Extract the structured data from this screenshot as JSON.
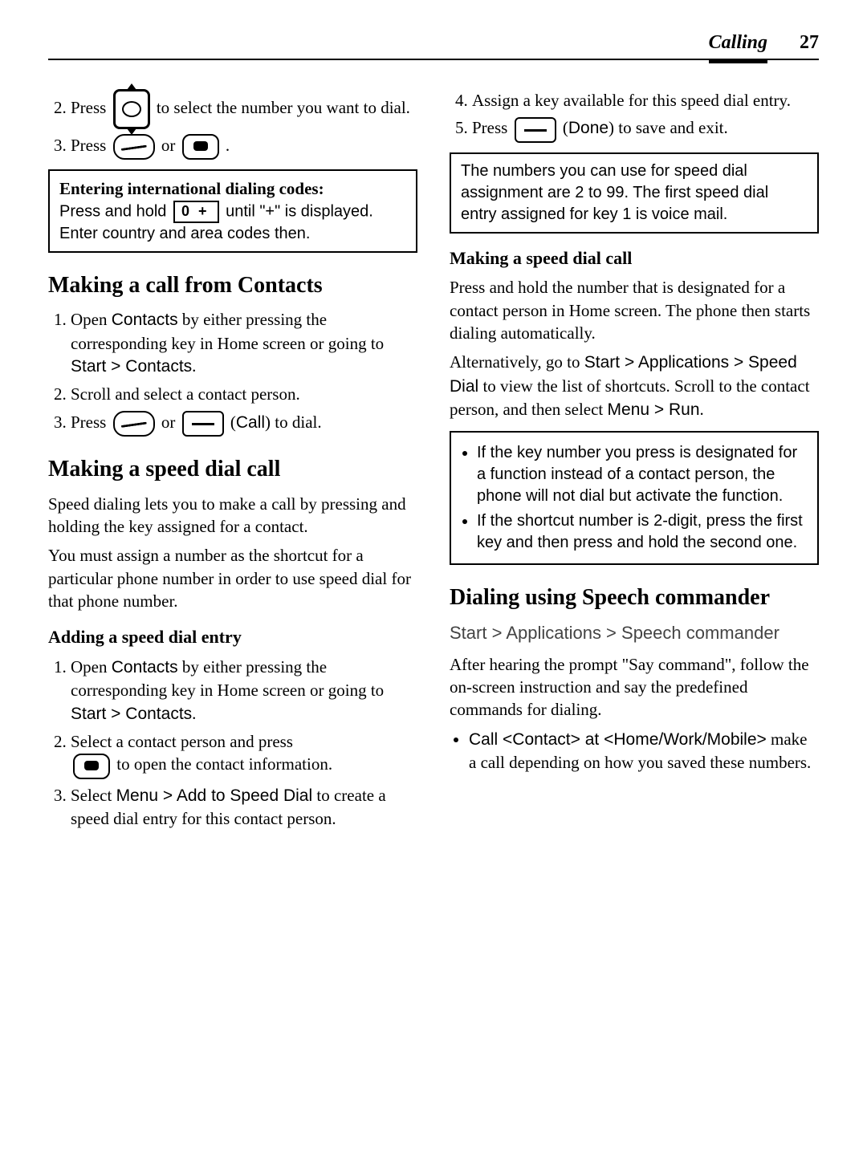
{
  "header": {
    "section": "Calling",
    "pageNumber": "27"
  },
  "left": {
    "steps_top": [
      {
        "pre": "Press ",
        "post": " to select the number you want to dial."
      },
      {
        "pre": "Press ",
        "mid": " or ",
        "post": " ."
      }
    ],
    "intl_box": {
      "title": "Entering international dialing codes:",
      "pre": "Press and hold ",
      "key_label": "0 +",
      "post": " until \"+\" is displayed. Enter country and area codes then."
    },
    "h2_contacts": "Making a call from Contacts",
    "contacts_steps": {
      "s1_a": "Open ",
      "s1_b": "Contacts",
      "s1_c": " by either pressing the corresponding key in Home screen or going to ",
      "s1_d": "Start > Contacts",
      "s1_e": ".",
      "s2": "Scroll and select a contact person.",
      "s3_a": "Press ",
      "s3_b": " or ",
      "s3_c": " (",
      "s3_d": "Call",
      "s3_e": ") to dial."
    },
    "h2_speed": "Making a speed dial call",
    "speed_p1": "Speed dialing lets you to make a call by pressing and holding the key assigned for a contact.",
    "speed_p2": "You must assign a number as the shortcut for a particular phone number in order to use speed dial for that phone number.",
    "h3_add": "Adding a speed dial entry",
    "add_steps": {
      "s1_a": "Open ",
      "s1_b": "Contacts",
      "s1_c": " by either pressing the corresponding key in Home screen or going to ",
      "s1_d": "Start > Contacts",
      "s1_e": ".",
      "s2_a": "Select a contact person and press ",
      "s2_b": " to open the contact information.",
      "s3_a": "Select ",
      "s3_b": "Menu > Add to Speed Dial",
      "s3_c": " to create a speed dial entry for this contact person."
    }
  },
  "right": {
    "steps_top": {
      "s4": "Assign a key available for this speed dial entry.",
      "s5_a": "Press ",
      "s5_b": " (",
      "s5_c": "Done",
      "s5_d": ") to save and exit."
    },
    "note_speed_range": "The numbers you can use for speed dial assignment are 2 to 99. The first speed dial entry assigned for key 1 is voice mail.",
    "h3_making": "Making a speed dial call",
    "making_p1": "Press and hold the number that is designated for a contact person in Home screen. The phone then starts dialing automatically.",
    "making_p2_a": "Alternatively, go to ",
    "making_p2_b": "Start > Applications > Speed Dial",
    "making_p2_c": " to view the list of shortcuts. Scroll to the contact person, and then select ",
    "making_p2_d": "Menu > Run",
    "making_p2_e": ".",
    "note_list": [
      "If the key number you press is designated for a function instead of a contact person, the phone will not dial but activate the function.",
      "If the shortcut number is 2-digit, press the first key and then press and hold the second one."
    ],
    "h2_speech": "Dialing using Speech commander",
    "speech_path": "Start > Applications > Speech commander",
    "speech_p": "After hearing the prompt \"Say command\", follow the on-screen instruction and say the predefined commands for dialing.",
    "cmd_a": "Call <Contact> at <Home/Work/Mobile>",
    "cmd_b": " make a call depending on how you saved these numbers."
  }
}
